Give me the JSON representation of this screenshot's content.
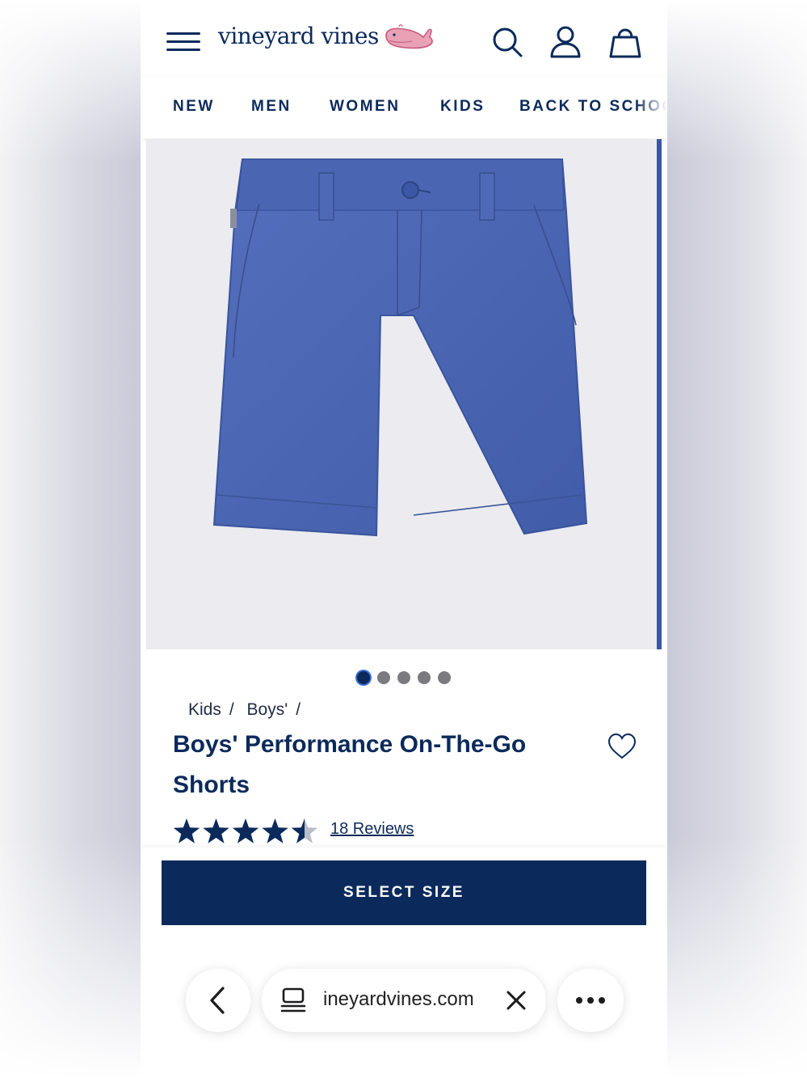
{
  "brand": {
    "name": "vineyard vines",
    "logo_color": "#e07a97"
  },
  "header": {
    "menu_icon": "hamburger-menu-icon",
    "search_icon": "search-icon",
    "account_icon": "account-icon",
    "bag_icon": "shopping-bag-icon"
  },
  "nav": {
    "items": [
      "NEW",
      "MEN",
      "WOMEN",
      "KIDS",
      "BACK TO SCHOOL"
    ]
  },
  "gallery": {
    "image_alt": "Boys' Performance On-The-Go Shorts",
    "image_count": 5,
    "active_index": 0
  },
  "product": {
    "breadcrumb": [
      "Kids",
      "Boys'"
    ],
    "title": "Boys' Performance On-The-Go Shorts",
    "rating": 4.5,
    "rating_max": 5,
    "reviews_label": "18 Reviews",
    "favorite_icon": "heart-icon"
  },
  "actions": {
    "select_size": "SELECT SIZE"
  },
  "browser": {
    "back_icon": "chevron-left-icon",
    "tabs_icon": "tab-overview-icon",
    "url": "ineyardvines.com",
    "close_icon": "close-icon",
    "more_icon": "more-icon"
  },
  "colors": {
    "navy": "#0b2a5b",
    "shorts_blue": "#4b67b3"
  }
}
